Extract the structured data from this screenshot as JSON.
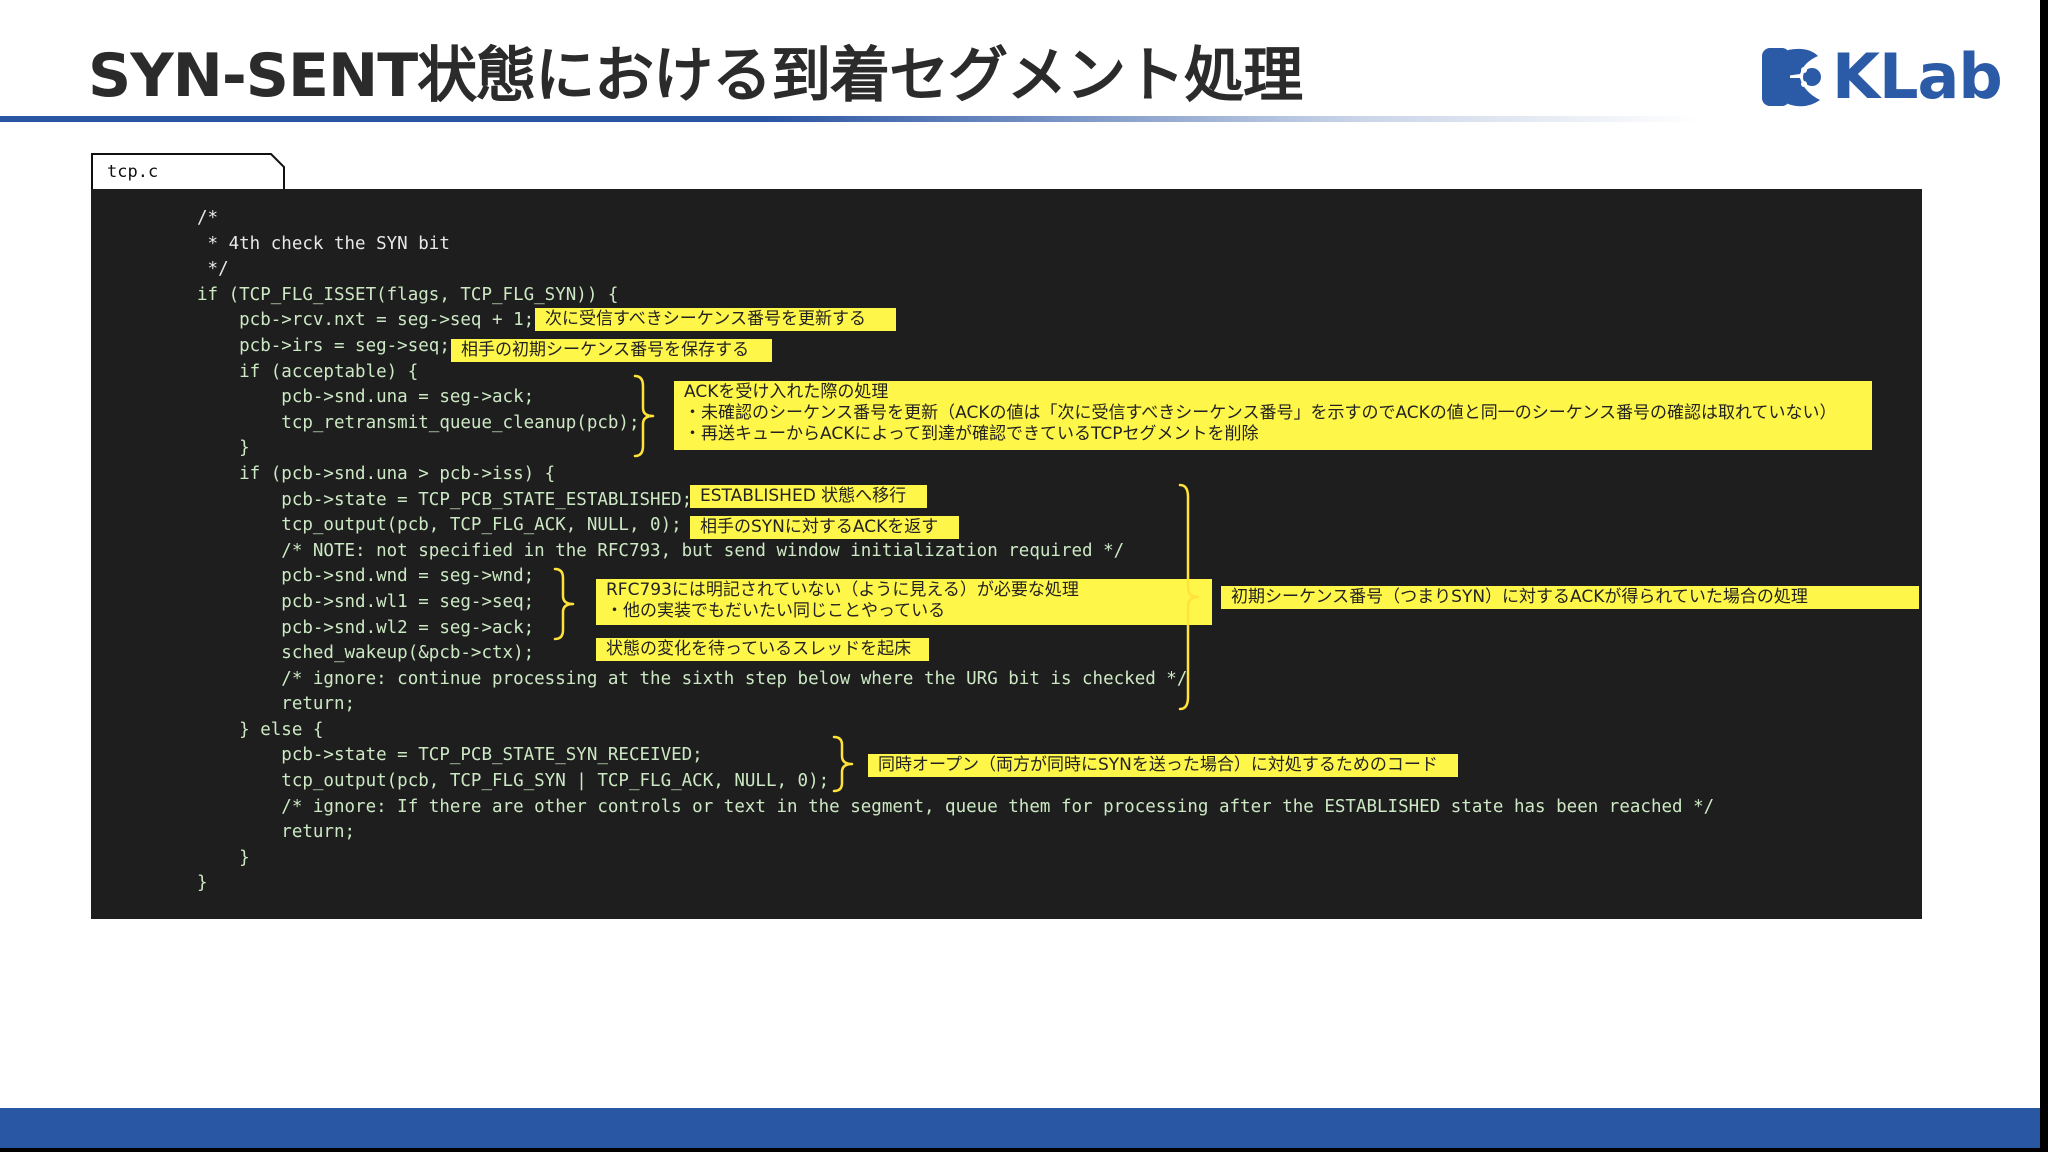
{
  "slide": {
    "title": "SYN-SENT状態における到着セグメント処理",
    "logo_text": "KLab"
  },
  "colors": {
    "accent_blue": "#2957a4",
    "code_background": "#1e1e1e",
    "note_yellow": "#fff64a",
    "brace_yellow": "#ffe23a"
  },
  "file_tab": {
    "label": "tcp.c"
  },
  "code_lines": [
    {
      "text": "/*",
      "style": "white"
    },
    {
      "text": " * 4th check the SYN bit",
      "style": "white"
    },
    {
      "text": " */",
      "style": "white"
    },
    {
      "text": "if (TCP_FLG_ISSET(flags, TCP_FLG_SYN)) {",
      "style": "green"
    },
    {
      "text": "    pcb->rcv.nxt = seg->seq + 1;",
      "style": "green"
    },
    {
      "text": "    pcb->irs = seg->seq;",
      "style": "green"
    },
    {
      "text": "    if (acceptable) {",
      "style": "green"
    },
    {
      "text": "        pcb->snd.una = seg->ack;",
      "style": "green"
    },
    {
      "text": "        tcp_retransmit_queue_cleanup(pcb);",
      "style": "green"
    },
    {
      "text": "    }",
      "style": "green"
    },
    {
      "text": "    if (pcb->snd.una > pcb->iss) {",
      "style": "green"
    },
    {
      "text": "        pcb->state = TCP_PCB_STATE_ESTABLISHED;",
      "style": "green"
    },
    {
      "text": "        tcp_output(pcb, TCP_FLG_ACK, NULL, 0);",
      "style": "green"
    },
    {
      "text": "        /* NOTE: not specified in the RFC793, but send window initialization required */",
      "style": "green"
    },
    {
      "text": "        pcb->snd.wnd = seg->wnd;",
      "style": "green"
    },
    {
      "text": "        pcb->snd.wl1 = seg->seq;",
      "style": "green"
    },
    {
      "text": "        pcb->snd.wl2 = seg->ack;",
      "style": "green"
    },
    {
      "text": "        sched_wakeup(&pcb->ctx);",
      "style": "green"
    },
    {
      "text": "        /* ignore: continue processing at the sixth step below where the URG bit is checked */",
      "style": "green"
    },
    {
      "text": "        return;",
      "style": "green"
    },
    {
      "text": "    } else {",
      "style": "green"
    },
    {
      "text": "        pcb->state = TCP_PCB_STATE_SYN_RECEIVED;",
      "style": "green"
    },
    {
      "text": "        tcp_output(pcb, TCP_FLG_SYN | TCP_FLG_ACK, NULL, 0);",
      "style": "green"
    },
    {
      "text": "        /* ignore: If there are other controls or text in the segment, queue them for processing after the ESTABLISHED state has been reached */",
      "style": "green"
    },
    {
      "text": "        return;",
      "style": "green"
    },
    {
      "text": "    }",
      "style": "green"
    },
    {
      "text": "}",
      "style": "green"
    }
  ],
  "notes": {
    "rcv_nxt": {
      "lines": [
        "次に受信すべきシーケンス番号を更新する"
      ]
    },
    "irs": {
      "lines": [
        "相手の初期シーケンス番号を保存する"
      ]
    },
    "ack_accept": {
      "lines": [
        "ACKを受け入れた際の処理",
        "・未確認のシーケンス番号を更新（ACKの値は「次に受信すべきシーケンス番号」を示すのでACKの値と同一のシーケンス番号の確認は取れていない）",
        "・再送キューからACKによって到達が確認できているTCPセグメントを削除"
      ]
    },
    "established": {
      "lines": [
        "ESTABLISHED 状態へ移行"
      ]
    },
    "syn_ack": {
      "lines": [
        "相手のSYNに対するACKを返す"
      ]
    },
    "rfc793": {
      "lines": [
        "RFC793には明記されていない（ように見える）が必要な処理",
        "・他の実装でもだいたい同じことやっている"
      ]
    },
    "wakeup": {
      "lines": [
        "状態の変化を待っているスレッドを起床"
      ]
    },
    "initial_seq": {
      "lines": [
        "初期シーケンス番号（つまりSYN）に対するACKが得られていた場合の処理"
      ]
    },
    "simultaneous_open": {
      "lines": [
        "同時オープン（両方が同時にSYNを送った場合）に対処するためのコード"
      ]
    }
  }
}
